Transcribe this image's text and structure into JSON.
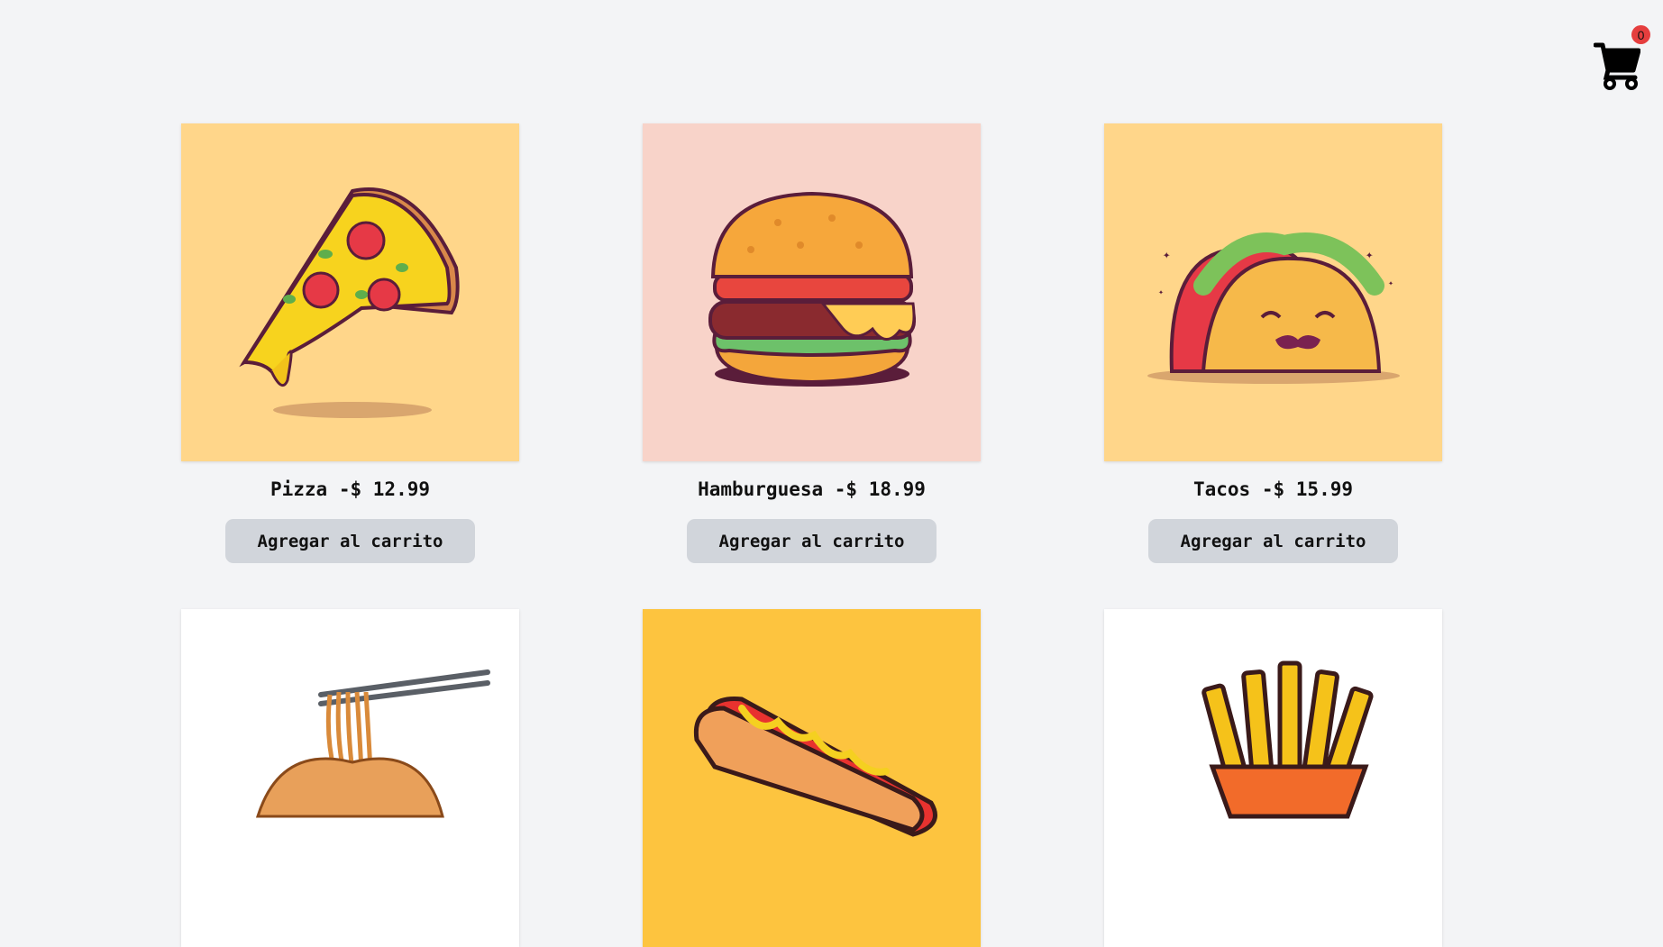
{
  "cart": {
    "count": "0",
    "icon": "shopping-cart-icon"
  },
  "products": [
    {
      "name": "Pizza",
      "separator": " -$ ",
      "price": "12.99",
      "button": "Agregar al carrito",
      "image": "pizza-slice-illustration",
      "bg": "#ffd68a"
    },
    {
      "name": "Hamburguesa",
      "separator": " -$ ",
      "price": "18.99",
      "button": "Agregar al carrito",
      "image": "hamburger-illustration",
      "bg": "#f8d3c9"
    },
    {
      "name": "Tacos",
      "separator": " -$ ",
      "price": "15.99",
      "button": "Agregar al carrito",
      "image": "taco-illustration",
      "bg": "#ffd68a"
    },
    {
      "image": "noodles-illustration",
      "bg": "#ffffff"
    },
    {
      "image": "hot-dog-illustration",
      "bg": "#fdc43f"
    },
    {
      "image": "french-fries-illustration",
      "bg": "#ffffff"
    }
  ]
}
